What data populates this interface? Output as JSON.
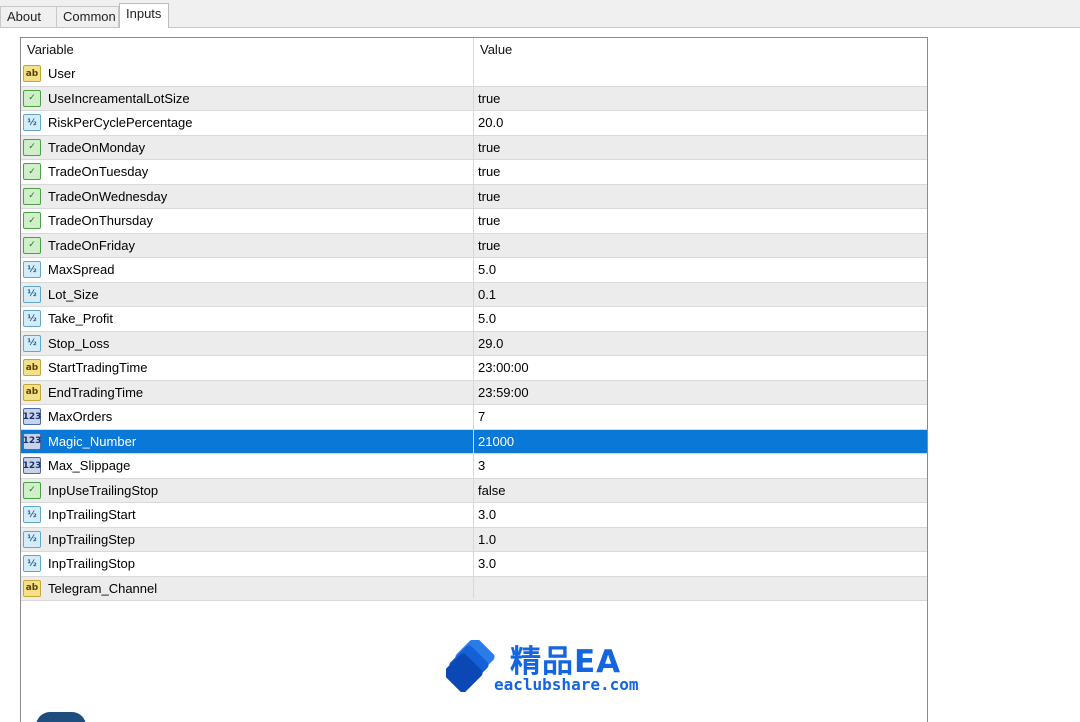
{
  "tabs": [
    "About",
    "Common",
    "Inputs"
  ],
  "active_tab": "Inputs",
  "grid": {
    "col_variable": "Variable",
    "col_value": "Value",
    "selected_index": 15,
    "rows": [
      {
        "type": "string",
        "name": "User",
        "value": ""
      },
      {
        "type": "bool",
        "name": "UseIncreamentalLotSize",
        "value": "true"
      },
      {
        "type": "double",
        "name": "RiskPerCyclePercentage",
        "value": "20.0"
      },
      {
        "type": "bool",
        "name": "TradeOnMonday",
        "value": "true"
      },
      {
        "type": "bool",
        "name": "TradeOnTuesday",
        "value": "true"
      },
      {
        "type": "bool",
        "name": "TradeOnWednesday",
        "value": "true"
      },
      {
        "type": "bool",
        "name": "TradeOnThursday",
        "value": "true"
      },
      {
        "type": "bool",
        "name": "TradeOnFriday",
        "value": "true"
      },
      {
        "type": "double",
        "name": "MaxSpread",
        "value": "5.0"
      },
      {
        "type": "double",
        "name": "Lot_Size",
        "value": "0.1"
      },
      {
        "type": "double",
        "name": "Take_Profit",
        "value": "5.0"
      },
      {
        "type": "double",
        "name": "Stop_Loss",
        "value": "29.0"
      },
      {
        "type": "string",
        "name": "StartTradingTime",
        "value": "23:00:00"
      },
      {
        "type": "string",
        "name": "EndTradingTime",
        "value": "23:59:00"
      },
      {
        "type": "int",
        "name": "MaxOrders",
        "value": "7"
      },
      {
        "type": "int",
        "name": "Magic_Number",
        "value": "21000"
      },
      {
        "type": "int",
        "name": "Max_Slippage",
        "value": "3"
      },
      {
        "type": "bool",
        "name": "InpUseTrailingStop",
        "value": "false"
      },
      {
        "type": "double",
        "name": "InpTrailingStart",
        "value": "3.0"
      },
      {
        "type": "double",
        "name": "InpTrailingStep",
        "value": "1.0"
      },
      {
        "type": "double",
        "name": "InpTrailingStop",
        "value": "3.0"
      },
      {
        "type": "string",
        "name": "Telegram_Channel",
        "value": ""
      }
    ]
  },
  "icons": {
    "string": {
      "name": "string-type-icon",
      "glyph": "ab"
    },
    "bool": {
      "name": "bool-type-icon",
      "glyph": "✓"
    },
    "double": {
      "name": "double-type-icon",
      "glyph": "½"
    },
    "int": {
      "name": "int-type-icon",
      "glyph": "123"
    }
  },
  "watermark": {
    "title": "精品EA",
    "url": "eaclubshare.com"
  },
  "colors": {
    "selection": "#0a78d7",
    "watermark": "#1465e0"
  }
}
